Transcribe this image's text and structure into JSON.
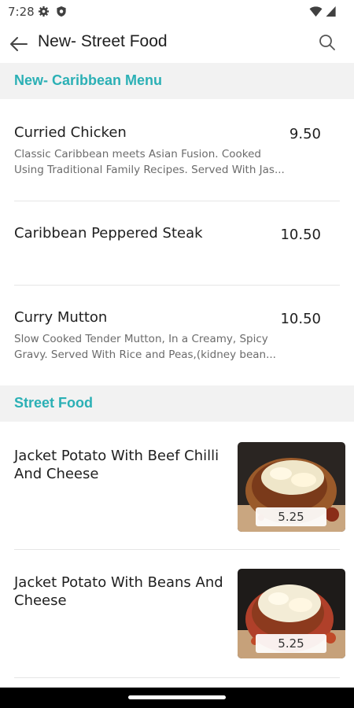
{
  "status_bar": {
    "time": "7:28"
  },
  "app_bar": {
    "title": "New- Street Food"
  },
  "sections": [
    {
      "title": "New- Caribbean Menu",
      "items": [
        {
          "name": "Curried Chicken",
          "price": "9.50",
          "desc_line1": "Classic Caribbean meets Asian Fusion. Cooked",
          "desc_line2": "Using Traditional Family Recipes. Served With Jas..."
        },
        {
          "name": "Caribbean Peppered Steak",
          "price": "10.50"
        },
        {
          "name": "Curry Mutton",
          "price": "10.50",
          "desc_line1": "Slow Cooked Tender Mutton, In a Creamy, Spicy",
          "desc_line2": "Gravy. Served With Rice and Peas,(kidney bean..."
        }
      ]
    },
    {
      "title": "Street Food",
      "items": [
        {
          "name": "Jacket Potato With Beef Chilli And Cheese",
          "price": "5.25",
          "image": "jacket-potato-beef-chilli-photo"
        },
        {
          "name": "Jacket Potato With Beans And Cheese",
          "price": "5.25",
          "image": "jacket-potato-beans-photo"
        }
      ]
    }
  ],
  "colors": {
    "accent": "#2bb0b5",
    "section_bg": "#f2f2f2",
    "text": "#202020",
    "muted": "#6b6b6b"
  },
  "icons": [
    "settings-gear-icon",
    "shield-icon",
    "wifi-icon",
    "signal-icon",
    "back-arrow-icon",
    "search-icon"
  ]
}
